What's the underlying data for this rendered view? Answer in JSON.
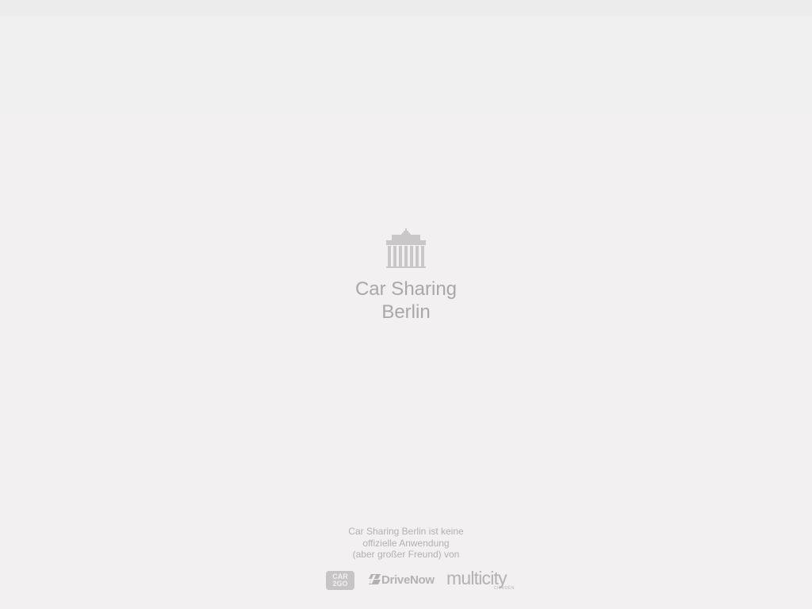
{
  "app": {
    "title_line1": "Car Sharing",
    "title_line2": "Berlin",
    "logo_icon": "brandenburg-gate-icon"
  },
  "disclaimer": {
    "line1": "Car Sharing Berlin ist keine",
    "line2": "offizielle Anwendung",
    "line3": "(aber großer Freund) von"
  },
  "partners": {
    "car2go_line1": "CAR",
    "car2go_line2": "2GO",
    "drivenow": "DriveNow",
    "multicity": "multicity",
    "multicity_sub": "CITROËN"
  },
  "colors": {
    "background": "#f2f0f1",
    "status_bar": "#ececec",
    "text_muted": "#a9a7a8",
    "logo_gray": "#b3b1b2"
  }
}
